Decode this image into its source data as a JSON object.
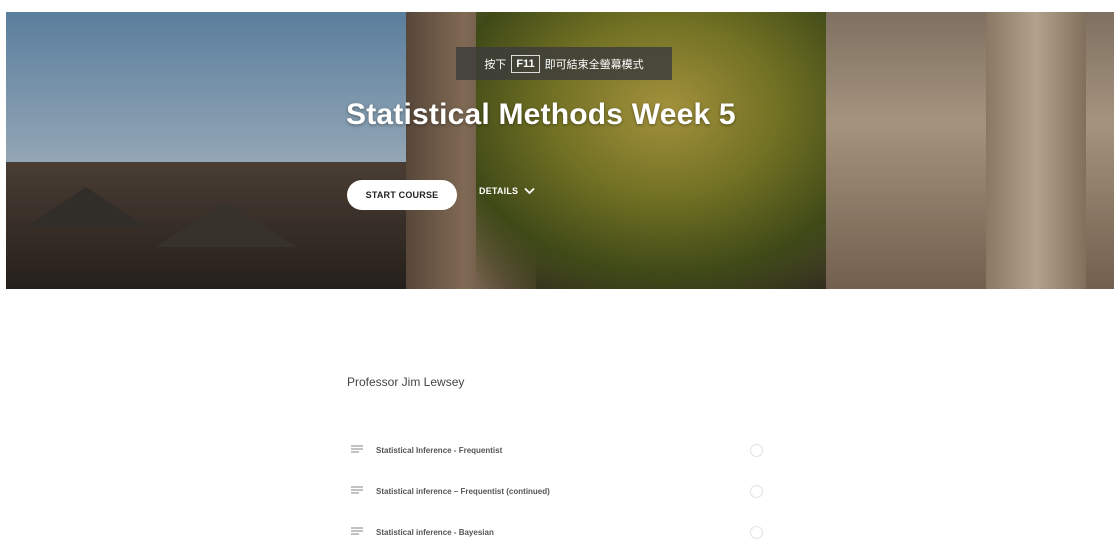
{
  "fullscreen_notice": {
    "prefix": "按下",
    "key": "F11",
    "suffix": "即可結束全螢幕模式"
  },
  "course": {
    "title": "Statistical Methods Week 5",
    "start_label": "START COURSE",
    "details_label": "DETAILS",
    "author": "Professor Jim Lewsey"
  },
  "lessons": [
    {
      "label": "Statistical Inference - Frequentist",
      "icon": "text-lines-icon",
      "complete": false
    },
    {
      "label": "Statistical inference – Frequentist (continued)",
      "icon": "text-lines-icon",
      "complete": false
    },
    {
      "label": "Statistical inference - Bayesian",
      "icon": "text-lines-icon",
      "complete": false
    }
  ],
  "colors": {
    "button_bg": "#ffffff",
    "title_text": "#ffffff",
    "lesson_text": "#555555",
    "status_circle": "#e2e2e2"
  }
}
